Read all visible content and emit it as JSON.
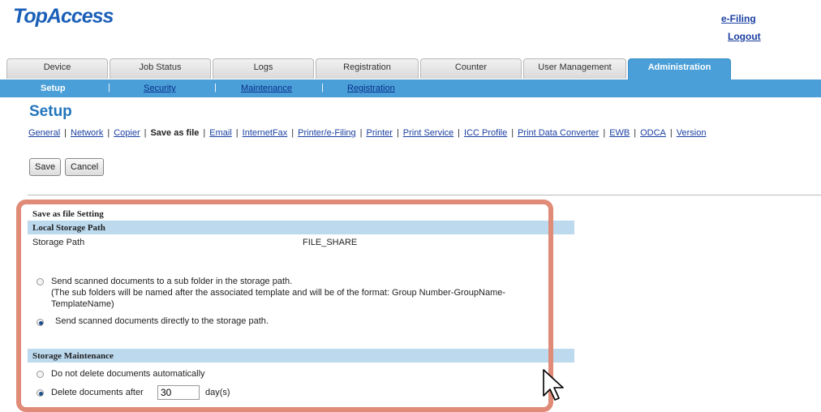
{
  "app": {
    "logo": "TopAccess",
    "links": {
      "efiling": "e-Filing",
      "logout": "Logout"
    }
  },
  "tabs": [
    {
      "label": "Device",
      "active": false
    },
    {
      "label": "Job Status",
      "active": false
    },
    {
      "label": "Logs",
      "active": false
    },
    {
      "label": "Registration",
      "active": false
    },
    {
      "label": "Counter",
      "active": false
    },
    {
      "label": "User Management",
      "active": false
    },
    {
      "label": "Administration",
      "active": true
    }
  ],
  "subnav": [
    {
      "label": "Setup",
      "active": true
    },
    {
      "label": "Security",
      "active": false
    },
    {
      "label": "Maintenance",
      "active": false
    },
    {
      "label": "Registration",
      "active": false
    }
  ],
  "page": {
    "title": "Setup",
    "sublinks": [
      "General",
      "Network",
      "Copier",
      "Save as file",
      "Email",
      "InternetFax",
      "Printer/e-Filing",
      "Printer",
      "Print Service",
      "ICC Profile",
      "Print Data Converter",
      "EWB",
      "ODCA",
      "Version"
    ],
    "current_sublink": "Save as file"
  },
  "buttons": {
    "save": "Save",
    "cancel": "Cancel"
  },
  "form": {
    "section_title": "Save as file Setting",
    "local_storage": {
      "header": "Local Storage Path",
      "path_label": "Storage Path",
      "path_value": "FILE_SHARE",
      "option1_line1": "Send scanned documents to a sub folder in the storage path.",
      "option1_line2": "(The sub folders will be named after the associated template and will be of the format: Group Number-GroupName-",
      "option1_line3": "TemplateName)",
      "option2": "Send scanned documents directly to the storage path.",
      "selected": 2
    },
    "storage_maintenance": {
      "header": "Storage Maintenance",
      "option1": "Do not delete documents automatically",
      "option2_prefix": "Delete documents after",
      "days_value": "30",
      "days_unit": "day(s)",
      "selected": 2
    }
  },
  "colors": {
    "accent": "#4a9fd8",
    "band": "#bcd9ee",
    "highlight": "#e08a78",
    "title": "#2276bd"
  }
}
